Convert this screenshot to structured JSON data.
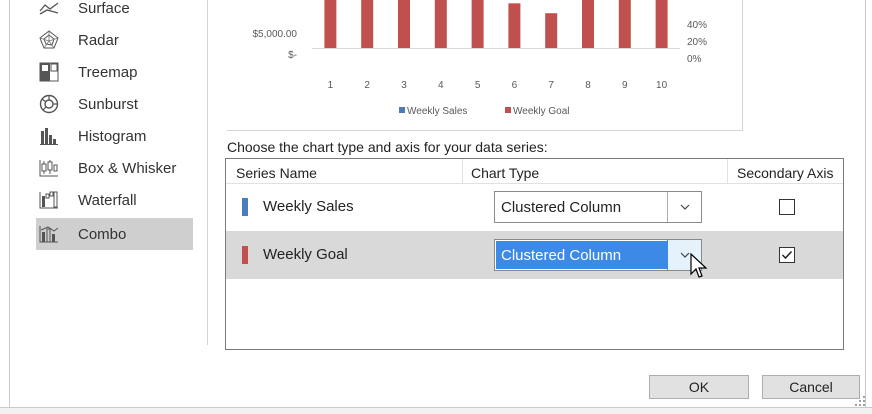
{
  "sidebar": {
    "items": [
      {
        "label": "Surface",
        "icon": "surface-chart-icon"
      },
      {
        "label": "Radar",
        "icon": "radar-chart-icon"
      },
      {
        "label": "Treemap",
        "icon": "treemap-chart-icon"
      },
      {
        "label": "Sunburst",
        "icon": "sunburst-chart-icon"
      },
      {
        "label": "Histogram",
        "icon": "histogram-chart-icon"
      },
      {
        "label": "Box & Whisker",
        "icon": "box-whisker-chart-icon"
      },
      {
        "label": "Waterfall",
        "icon": "waterfall-chart-icon"
      },
      {
        "label": "Combo",
        "icon": "combo-chart-icon",
        "selected": true
      }
    ]
  },
  "chart_data": {
    "type": "bar",
    "categories": [
      "1",
      "2",
      "3",
      "4",
      "5",
      "6",
      "7",
      "8",
      "9",
      "10"
    ],
    "left_tick_labels": [
      "$5,000.00",
      "$-"
    ],
    "right_tick_labels": [
      "40%",
      "20%",
      "0%"
    ],
    "series": [
      {
        "name": "Weekly Sales",
        "color": "#4a7ebb",
        "values": [
          null,
          null,
          null,
          null,
          null,
          null,
          null,
          null,
          null,
          null
        ]
      },
      {
        "name": "Weekly Goal",
        "color": "#c0504d",
        "values": [
          1.0,
          1.0,
          1.0,
          1.0,
          1.0,
          0.77,
          0.6,
          1.0,
          1.0,
          1.0
        ]
      }
    ],
    "legend": "bottom"
  },
  "prompt": "Choose the chart type and axis for your data series:",
  "table": {
    "headers": {
      "series_name": "Series Name",
      "chart_type": "Chart Type",
      "secondary_axis": "Secondary Axis"
    },
    "rows": [
      {
        "name": "Weekly Sales",
        "color": "#4a7ebb",
        "chart_type": "Clustered Column",
        "secondary_axis": false,
        "selected": false
      },
      {
        "name": "Weekly Goal",
        "color": "#c0504d",
        "chart_type": "Clustered Column",
        "secondary_axis": true,
        "selected": true
      }
    ]
  },
  "buttons": {
    "ok": "OK",
    "cancel": "Cancel"
  }
}
